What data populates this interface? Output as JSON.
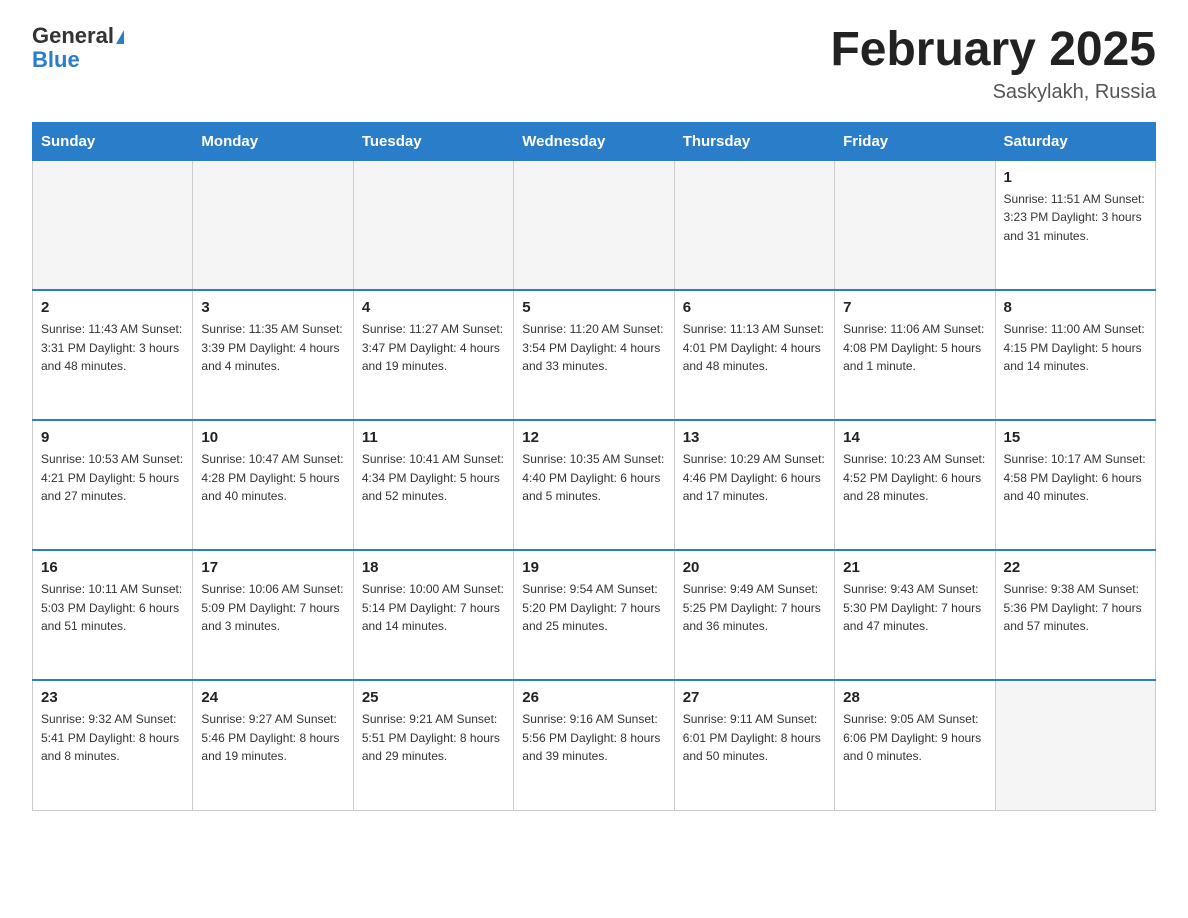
{
  "header": {
    "logo_general": "General",
    "logo_blue": "Blue",
    "title": "February 2025",
    "subtitle": "Saskylakh, Russia"
  },
  "weekdays": [
    "Sunday",
    "Monday",
    "Tuesday",
    "Wednesday",
    "Thursday",
    "Friday",
    "Saturday"
  ],
  "weeks": [
    [
      {
        "day": "",
        "info": ""
      },
      {
        "day": "",
        "info": ""
      },
      {
        "day": "",
        "info": ""
      },
      {
        "day": "",
        "info": ""
      },
      {
        "day": "",
        "info": ""
      },
      {
        "day": "",
        "info": ""
      },
      {
        "day": "1",
        "info": "Sunrise: 11:51 AM\nSunset: 3:23 PM\nDaylight: 3 hours\nand 31 minutes."
      }
    ],
    [
      {
        "day": "2",
        "info": "Sunrise: 11:43 AM\nSunset: 3:31 PM\nDaylight: 3 hours\nand 48 minutes."
      },
      {
        "day": "3",
        "info": "Sunrise: 11:35 AM\nSunset: 3:39 PM\nDaylight: 4 hours\nand 4 minutes."
      },
      {
        "day": "4",
        "info": "Sunrise: 11:27 AM\nSunset: 3:47 PM\nDaylight: 4 hours\nand 19 minutes."
      },
      {
        "day": "5",
        "info": "Sunrise: 11:20 AM\nSunset: 3:54 PM\nDaylight: 4 hours\nand 33 minutes."
      },
      {
        "day": "6",
        "info": "Sunrise: 11:13 AM\nSunset: 4:01 PM\nDaylight: 4 hours\nand 48 minutes."
      },
      {
        "day": "7",
        "info": "Sunrise: 11:06 AM\nSunset: 4:08 PM\nDaylight: 5 hours\nand 1 minute."
      },
      {
        "day": "8",
        "info": "Sunrise: 11:00 AM\nSunset: 4:15 PM\nDaylight: 5 hours\nand 14 minutes."
      }
    ],
    [
      {
        "day": "9",
        "info": "Sunrise: 10:53 AM\nSunset: 4:21 PM\nDaylight: 5 hours\nand 27 minutes."
      },
      {
        "day": "10",
        "info": "Sunrise: 10:47 AM\nSunset: 4:28 PM\nDaylight: 5 hours\nand 40 minutes."
      },
      {
        "day": "11",
        "info": "Sunrise: 10:41 AM\nSunset: 4:34 PM\nDaylight: 5 hours\nand 52 minutes."
      },
      {
        "day": "12",
        "info": "Sunrise: 10:35 AM\nSunset: 4:40 PM\nDaylight: 6 hours\nand 5 minutes."
      },
      {
        "day": "13",
        "info": "Sunrise: 10:29 AM\nSunset: 4:46 PM\nDaylight: 6 hours\nand 17 minutes."
      },
      {
        "day": "14",
        "info": "Sunrise: 10:23 AM\nSunset: 4:52 PM\nDaylight: 6 hours\nand 28 minutes."
      },
      {
        "day": "15",
        "info": "Sunrise: 10:17 AM\nSunset: 4:58 PM\nDaylight: 6 hours\nand 40 minutes."
      }
    ],
    [
      {
        "day": "16",
        "info": "Sunrise: 10:11 AM\nSunset: 5:03 PM\nDaylight: 6 hours\nand 51 minutes."
      },
      {
        "day": "17",
        "info": "Sunrise: 10:06 AM\nSunset: 5:09 PM\nDaylight: 7 hours\nand 3 minutes."
      },
      {
        "day": "18",
        "info": "Sunrise: 10:00 AM\nSunset: 5:14 PM\nDaylight: 7 hours\nand 14 minutes."
      },
      {
        "day": "19",
        "info": "Sunrise: 9:54 AM\nSunset: 5:20 PM\nDaylight: 7 hours\nand 25 minutes."
      },
      {
        "day": "20",
        "info": "Sunrise: 9:49 AM\nSunset: 5:25 PM\nDaylight: 7 hours\nand 36 minutes."
      },
      {
        "day": "21",
        "info": "Sunrise: 9:43 AM\nSunset: 5:30 PM\nDaylight: 7 hours\nand 47 minutes."
      },
      {
        "day": "22",
        "info": "Sunrise: 9:38 AM\nSunset: 5:36 PM\nDaylight: 7 hours\nand 57 minutes."
      }
    ],
    [
      {
        "day": "23",
        "info": "Sunrise: 9:32 AM\nSunset: 5:41 PM\nDaylight: 8 hours\nand 8 minutes."
      },
      {
        "day": "24",
        "info": "Sunrise: 9:27 AM\nSunset: 5:46 PM\nDaylight: 8 hours\nand 19 minutes."
      },
      {
        "day": "25",
        "info": "Sunrise: 9:21 AM\nSunset: 5:51 PM\nDaylight: 8 hours\nand 29 minutes."
      },
      {
        "day": "26",
        "info": "Sunrise: 9:16 AM\nSunset: 5:56 PM\nDaylight: 8 hours\nand 39 minutes."
      },
      {
        "day": "27",
        "info": "Sunrise: 9:11 AM\nSunset: 6:01 PM\nDaylight: 8 hours\nand 50 minutes."
      },
      {
        "day": "28",
        "info": "Sunrise: 9:05 AM\nSunset: 6:06 PM\nDaylight: 9 hours\nand 0 minutes."
      },
      {
        "day": "",
        "info": ""
      }
    ]
  ]
}
